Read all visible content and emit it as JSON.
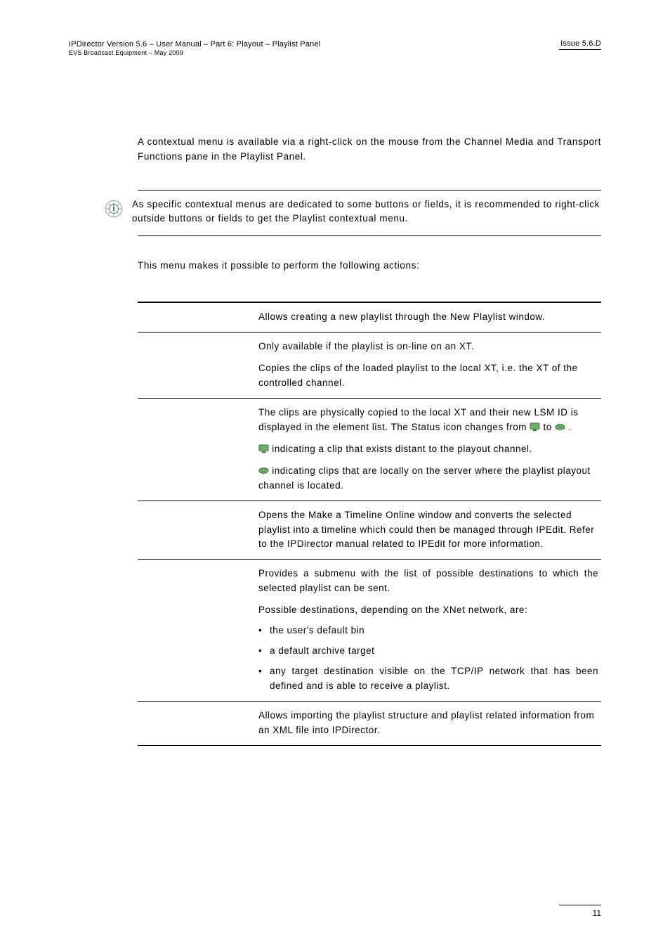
{
  "header": {
    "left_top": "IPDirector Version 5.6 – User Manual – Part 6: Playout – Playlist Panel",
    "left_sub": "EVS Broadcast Equipment – May 2009",
    "right": "Issue 5.6.D"
  },
  "intro": "A contextual menu is available via a right-click on the mouse from the Channel Media and Transport Functions pane in the Playlist Panel.",
  "note": "As specific contextual menus are dedicated to some buttons or fields, it is recommended to right-click outside buttons or fields to get the Playlist contextual menu.",
  "after_note": "This menu makes it possible to perform the following actions:",
  "rows": [
    {
      "paras": [
        "Allows creating a new playlist through the New Playlist window."
      ]
    },
    {
      "p1": "Only available if the playlist is on-line on an XT.",
      "p2": "Copies the clips of the loaded playlist to the local XT, i.e. the XT of the controlled channel.",
      "p3a": "The clips are physically copied to the local XT and their new LSM ID is displayed in the element list. The Status icon changes from ",
      "p3b": " to ",
      "p3c": ".",
      "p4": " indicating a clip that exists distant to the playout channel.",
      "p5": " indicating clips that are locally on the server where the playlist playout channel is located."
    },
    {
      "paras": [
        "Opens the Make a Timeline Online window and converts the selected playlist into a timeline which could then be managed through IPEdit. Refer to the IPDirector manual related to IPEdit for more information."
      ]
    },
    {
      "p1": "Provides a submenu with the list of possible destinations to which the selected playlist can be sent.",
      "p2": "Possible destinations, depending on the XNet network, are:",
      "b1": "the user's default bin",
      "b2": "a default archive target",
      "b3": "any target destination visible on the TCP/IP network that has been defined and is able to receive a playlist."
    },
    {
      "paras": [
        "Allows importing the playlist structure and playlist related information from an XML file into IPDirector."
      ]
    }
  ],
  "page_number": "11"
}
